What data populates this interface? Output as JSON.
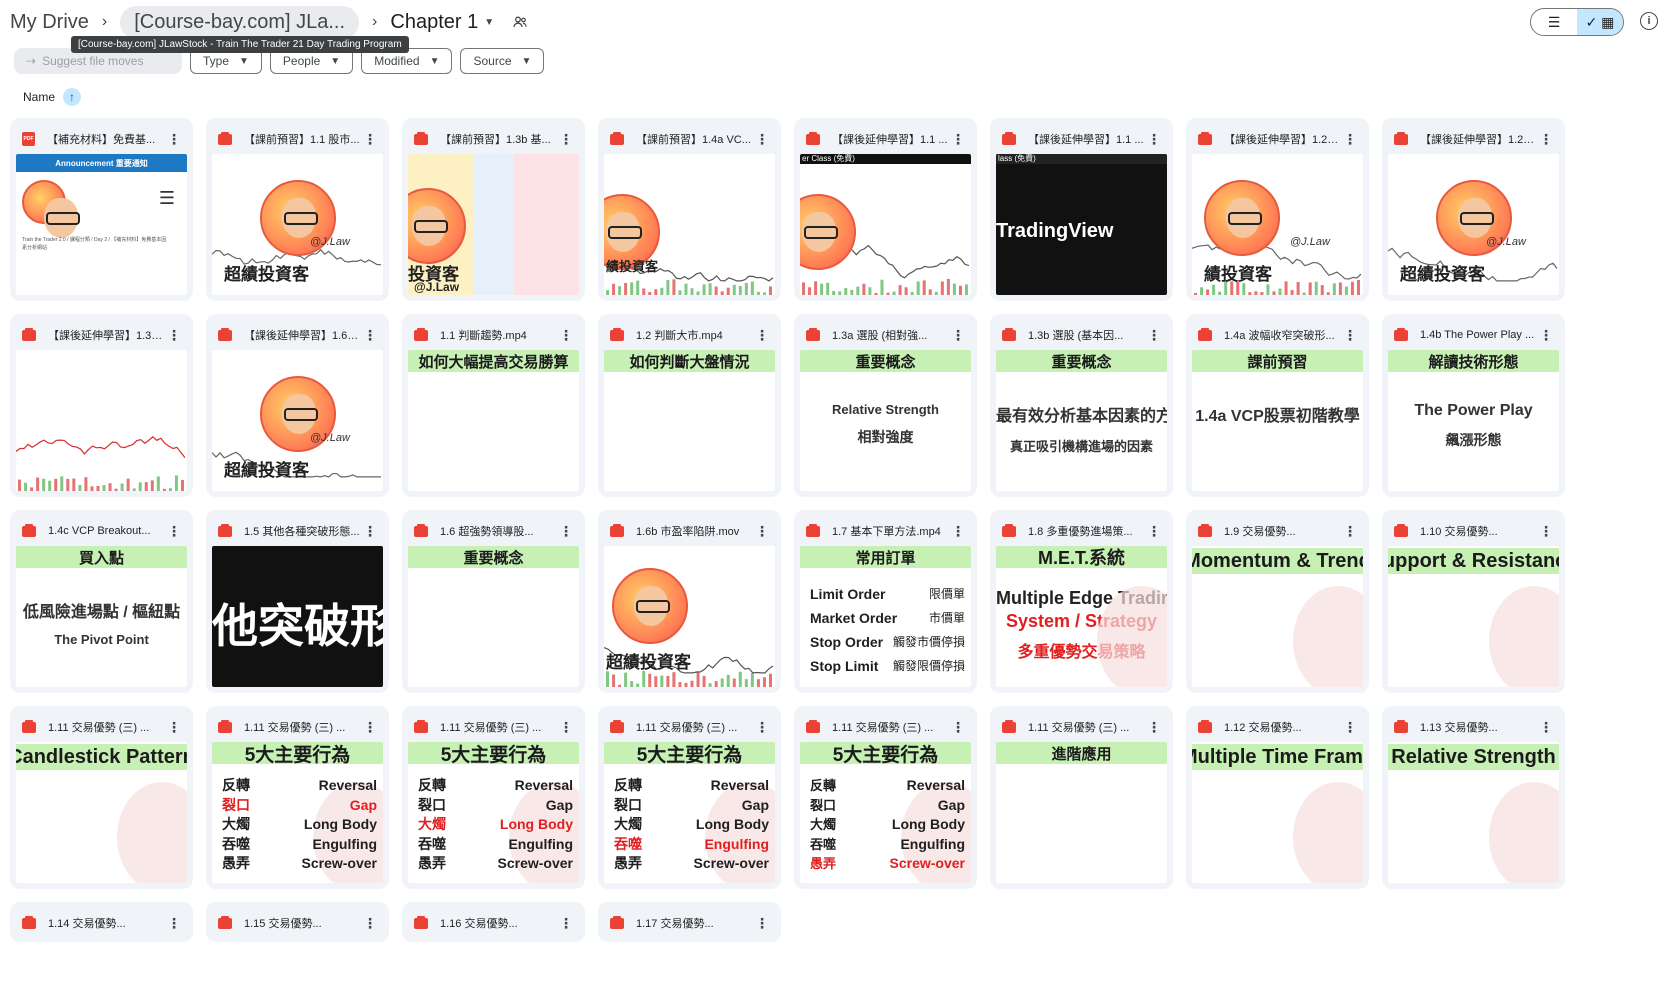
{
  "breadcrumb": {
    "root": "My Drive",
    "parent": "[Course-bay.com] JLa...",
    "current": "Chapter 1"
  },
  "tooltip": "[Course-bay.com] JLawStock - Train The Trader 21 Day Trading Program",
  "filters": {
    "suggest": "Suggest file moves",
    "chips": [
      "Type",
      "People",
      "Modified",
      "Source"
    ]
  },
  "sort": {
    "label": "Name"
  },
  "files": [
    {
      "title": "【補充材料】免費基...",
      "kind": "pdf",
      "thumb": "announce",
      "ann": "Announcement 重要通知",
      "caption": "Train the Trader 2.0 / 課程分類 / Day 2 / 【補充材料】免費基本因素分析網站"
    },
    {
      "title": "【課前預習】1.1 股市...",
      "kind": "video",
      "thumb": "avatar",
      "brand": "超績投資客",
      "handle": "@J.Law"
    },
    {
      "title": "【課前預習】1.3b 基...",
      "kind": "video",
      "thumb": "avatar-split",
      "brand": "投資客",
      "handle": "@J.Law"
    },
    {
      "title": "【課前預習】1.4a VC...",
      "kind": "video",
      "thumb": "avatar-chart",
      "brand": "績投資客"
    },
    {
      "title": "【課後延伸學習】1.1 ...",
      "kind": "video",
      "thumb": "avatar-chart2",
      "hdr": "er Class (免費)"
    },
    {
      "title": "【課後延伸學習】1.1 ...",
      "kind": "video",
      "thumb": "tradingview",
      "hdr": "lass (免費)",
      "tv": "TradingView"
    },
    {
      "title": "【課後延伸學習】1.2a...",
      "kind": "video",
      "thumb": "avatar-chart3",
      "brand": "績投資客",
      "handle": "@J.Law"
    },
    {
      "title": "【課後延伸學習】1.2b...",
      "kind": "video",
      "thumb": "avatar",
      "brand": "超績投資客",
      "handle": "@J.Law"
    },
    {
      "title": "【課後延伸學習】1.3a...",
      "kind": "video",
      "thumb": "chart"
    },
    {
      "title": "【課後延伸學習】1.6a...",
      "kind": "video",
      "thumb": "avatar",
      "brand": "超績投資客",
      "handle": "@J.Law"
    },
    {
      "title": "1.1 判斷趨勢.mp4",
      "kind": "video",
      "thumb": "green",
      "band": "如何大幅提高交易勝算"
    },
    {
      "title": "1.2 判斷大市.mp4",
      "kind": "video",
      "thumb": "green",
      "band": "如何判斷大盤情況"
    },
    {
      "title": "1.3a 選股 (相對強...",
      "kind": "video",
      "thumb": "green-two",
      "band": "重要概念",
      "l1": "Relative Strength",
      "l2": "相對強度"
    },
    {
      "title": "1.3b 選股 (基本因...",
      "kind": "video",
      "thumb": "green-two",
      "band": "重要概念",
      "l1": "最有效分析基本因素的方法",
      "l2": "真正吸引機構進場的因素"
    },
    {
      "title": "1.4a 波幅收窄突破形...",
      "kind": "video",
      "thumb": "green-two",
      "band": "課前預習",
      "l1": "1.4a VCP股票初階教學",
      "l2": ""
    },
    {
      "title": "1.4b The Power Play ...",
      "kind": "video",
      "thumb": "green-two",
      "band": "解讀技術形態",
      "l1": "The Power Play",
      "l2": "飆漲形態"
    },
    {
      "title": "1.4c VCP Breakout...",
      "kind": "video",
      "thumb": "green-two",
      "band": "買入點",
      "l1": "低風險進場點 / 樞紐點",
      "l2": "The Pivot Point"
    },
    {
      "title": "1.5 其他各種突破形態...",
      "kind": "video",
      "thumb": "dark-text",
      "big": "他突破形"
    },
    {
      "title": "1.6 超強勢領導股...",
      "kind": "video",
      "thumb": "green",
      "band": "重要概念"
    },
    {
      "title": "1.6b 市盈率陷阱.mov",
      "kind": "video",
      "thumb": "avatar-chart4",
      "brand": "超績投資客"
    },
    {
      "title": "1.7 基本下單方法.mp4",
      "kind": "video",
      "thumb": "orders",
      "band": "常用訂單",
      "rows": [
        [
          "Limit Order",
          "限價單"
        ],
        [
          "Market Order",
          "市價單"
        ],
        [
          "Stop Order",
          "觸發市價停損"
        ],
        [
          "Stop Limit",
          "觸發限價停損"
        ]
      ]
    },
    {
      "title": "1.8 多重優勢進場策...",
      "kind": "video",
      "thumb": "met",
      "band": "M.E.T.系統",
      "l1": "Multiple Edge Trading",
      "l2": "System / Strategy",
      "l3": "多重優勢交易策略"
    },
    {
      "title": "1.9 交易優勢...",
      "kind": "video",
      "thumb": "big-green",
      "big": "Momentum & Trend"
    },
    {
      "title": "1.10 交易優勢...",
      "kind": "video",
      "thumb": "big-green",
      "big": "Support & Resistance"
    },
    {
      "title": "1.11 交易優勢 (三) ...",
      "kind": "video",
      "thumb": "big-green",
      "big": "Candlestick Pattern"
    },
    {
      "title": "1.11 交易優勢 (三) ...",
      "kind": "video",
      "thumb": "five",
      "band": "5大主要行為",
      "hl": 1
    },
    {
      "title": "1.11 交易優勢 (三) ...",
      "kind": "video",
      "thumb": "five",
      "band": "5大主要行為",
      "hl": 2
    },
    {
      "title": "1.11 交易優勢 (三) ...",
      "kind": "video",
      "thumb": "five",
      "band": "5大主要行為",
      "hl": 3
    },
    {
      "title": "1.11 交易優勢 (三) ...",
      "kind": "video",
      "thumb": "five",
      "band": "5大主要行為",
      "hl": 4
    },
    {
      "title": "1.11 交易優勢 (三) ...",
      "kind": "video",
      "thumb": "green",
      "band": "進階應用"
    },
    {
      "title": "1.12 交易優勢...",
      "kind": "video",
      "thumb": "big-green",
      "big": "Multiple Time Frame"
    },
    {
      "title": "1.13 交易優勢...",
      "kind": "video",
      "thumb": "big-green",
      "big": "Relative Strength"
    },
    {
      "title": "1.14 交易優勢...",
      "kind": "video",
      "thumb": "none"
    },
    {
      "title": "1.15 交易優勢...",
      "kind": "video",
      "thumb": "none"
    },
    {
      "title": "1.16 交易優勢...",
      "kind": "video",
      "thumb": "none"
    },
    {
      "title": "1.17 交易優勢...",
      "kind": "video",
      "thumb": "none"
    }
  ],
  "five_rows": [
    [
      "反轉",
      "Reversal"
    ],
    [
      "裂口",
      "Gap"
    ],
    [
      "大燭",
      "Long Body"
    ],
    [
      "吞噬",
      "Engulfing"
    ],
    [
      "愚弄",
      "Screw-over"
    ]
  ],
  "colors": {
    "accent": "#c2e7ff",
    "band": "#c6f0b4",
    "card": "#f0f4f9",
    "highlight": "#e02020"
  }
}
